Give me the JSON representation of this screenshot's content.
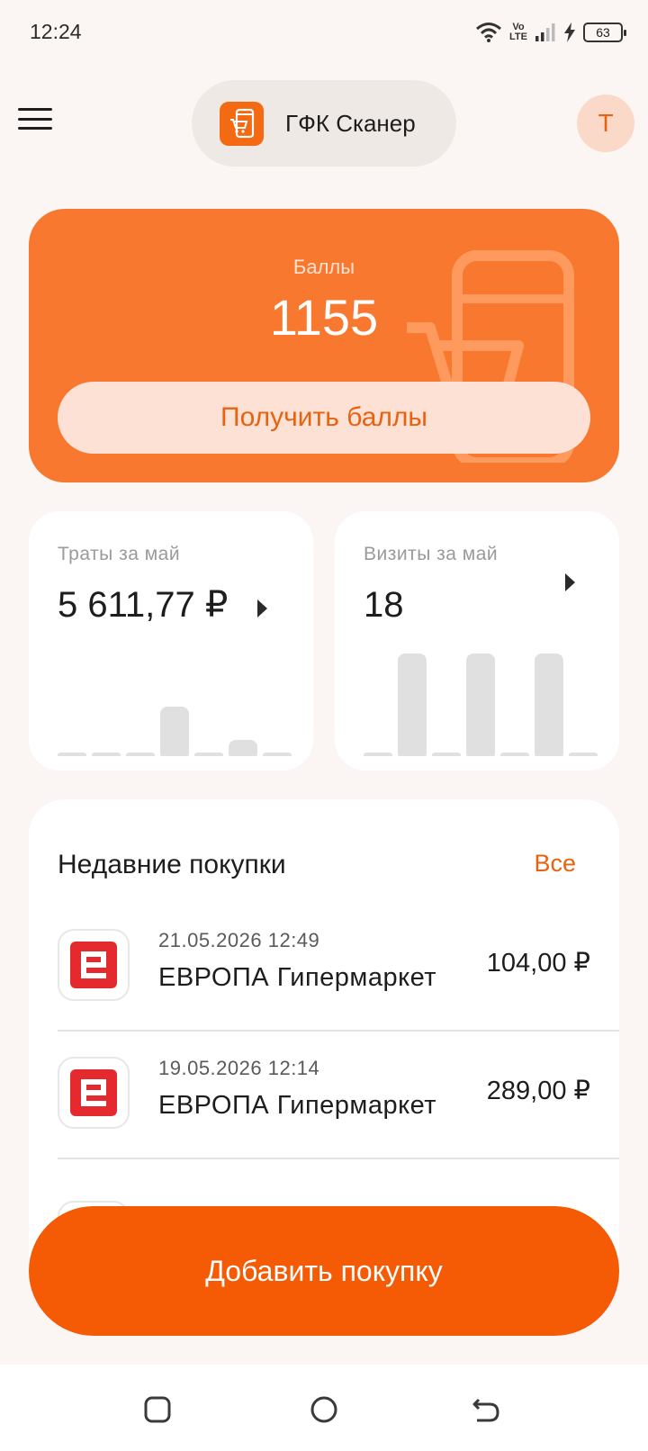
{
  "status_bar": {
    "time": "12:24",
    "network_label_top": "Vo",
    "network_label_bottom": "LTE",
    "battery_level": "63"
  },
  "header": {
    "menu_icon": "hamburger-menu-icon",
    "app_title": "ГФК Сканер",
    "app_logo_icon": "phone-cart-icon",
    "avatar_letter": "T"
  },
  "points": {
    "label": "Баллы",
    "value": "1155",
    "button_label": "Получить баллы"
  },
  "spend_stat": {
    "label": "Траты за май",
    "value": "5 611,77 ₽",
    "bars": [
      0,
      0,
      0,
      0.48,
      0,
      0.16,
      0
    ]
  },
  "visits_stat": {
    "label": "Визиты за май",
    "value": "18",
    "bars": [
      0,
      1,
      0,
      1,
      0,
      1,
      0
    ]
  },
  "recent": {
    "title": "Недавние покупки",
    "all_label": "Все",
    "items": [
      {
        "date": "21.05.2026 12:49",
        "store": "ЕВРОПА  Гипермаркет",
        "amount": "104,00 ₽"
      },
      {
        "date": "19.05.2026 12:14",
        "store": "ЕВРОПА  Гипермаркет",
        "amount": "289,00 ₽"
      }
    ]
  },
  "add_purchase": {
    "label": "Добавить покупку"
  },
  "colors": {
    "accent": "#F55A04",
    "card_orange": "#F7782E",
    "store_red": "#E42A2E"
  },
  "nav": {
    "recent_icon": "square-recents-icon",
    "home_icon": "circle-home-icon",
    "back_icon": "back-arrow-icon"
  }
}
